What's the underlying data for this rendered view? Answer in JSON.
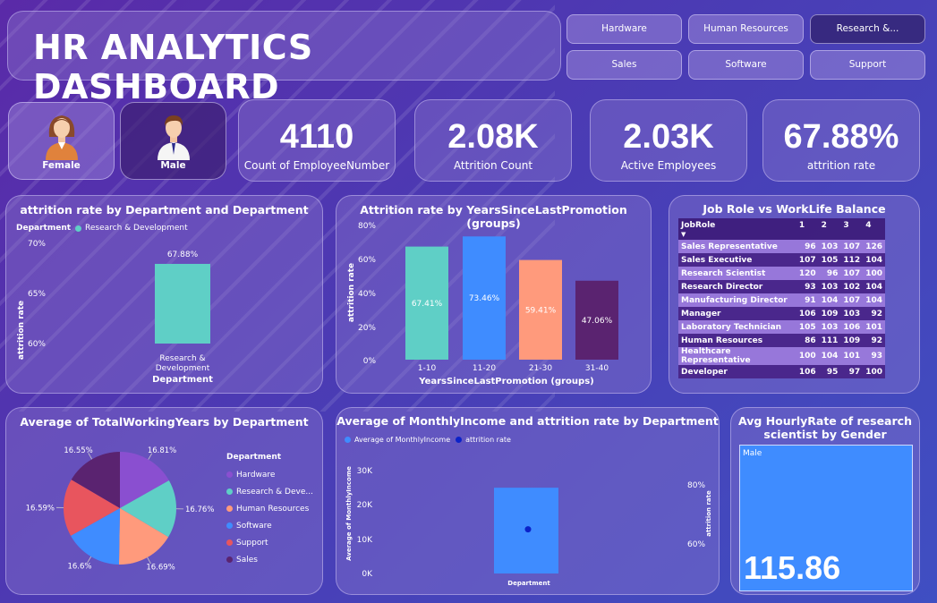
{
  "title": "HR ANALYTICS DASHBOARD",
  "slicers": [
    {
      "label": "Hardware",
      "selected": false
    },
    {
      "label": "Human Resources",
      "selected": false
    },
    {
      "label": "Research &...",
      "selected": true
    },
    {
      "label": "Sales",
      "selected": false
    },
    {
      "label": "Software",
      "selected": false
    },
    {
      "label": "Support",
      "selected": false
    }
  ],
  "gender": {
    "female": "Female",
    "male": "Male"
  },
  "kpis": [
    {
      "value": "4110",
      "caption": "Count of EmployeeNumber"
    },
    {
      "value": "2.08K",
      "caption": "Attrition Count"
    },
    {
      "value": "2.03K",
      "caption": "Active Employees"
    },
    {
      "value": "67.88%",
      "caption": "attrition rate"
    }
  ],
  "chart_data": [
    {
      "type": "bar",
      "title": "attrition rate by Department and Department",
      "legend_title": "Department",
      "legend": [
        "Research & Development"
      ],
      "categories": [
        "Research & Development"
      ],
      "category_lines": [
        "Research &",
        "Development"
      ],
      "values": [
        67.88
      ],
      "data_labels": [
        "67.88%"
      ],
      "ylabel": "attrition rate",
      "xlabel": "Department",
      "yticks": [
        "70%",
        "65%",
        "60%"
      ],
      "ylim": [
        60,
        70
      ],
      "color": "#5fcfc6"
    },
    {
      "type": "bar",
      "title": "Attrition rate by YearsSinceLastPromotion (groups)",
      "categories": [
        "1-10",
        "11-20",
        "21-30",
        "31-40"
      ],
      "values": [
        67.41,
        73.46,
        59.41,
        47.06
      ],
      "data_labels": [
        "67.41%",
        "73.46%",
        "59.41%",
        "47.06%"
      ],
      "colors": [
        "#5fcfc6",
        "#3f8cff",
        "#ff9a7c",
        "#5a2370"
      ],
      "ylabel": "attrition rate",
      "xlabel": "YearsSinceLastPromotion (groups)",
      "yticks": [
        "80%",
        "60%",
        "40%",
        "20%",
        "0%"
      ],
      "ylim": [
        0,
        80
      ]
    },
    {
      "type": "table",
      "title": "Job Role vs WorkLife Balance",
      "columns": [
        "JobRole",
        "1",
        "2",
        "3",
        "4"
      ],
      "rows": [
        [
          "Sales Representative",
          "96",
          "103",
          "107",
          "126"
        ],
        [
          "Sales Executive",
          "107",
          "105",
          "112",
          "104"
        ],
        [
          "Research Scientist",
          "120",
          "96",
          "107",
          "100"
        ],
        [
          "Research Director",
          "93",
          "103",
          "102",
          "104"
        ],
        [
          "Manufacturing Director",
          "91",
          "104",
          "107",
          "104"
        ],
        [
          "Manager",
          "106",
          "109",
          "103",
          "92"
        ],
        [
          "Laboratory Technician",
          "105",
          "103",
          "106",
          "101"
        ],
        [
          "Human Resources",
          "86",
          "111",
          "109",
          "92"
        ],
        [
          "Healthcare Representative",
          "100",
          "104",
          "101",
          "93"
        ],
        [
          "Developer",
          "106",
          "95",
          "97",
          "100"
        ]
      ]
    },
    {
      "type": "pie",
      "title": "Average of TotalWorkingYears by Department",
      "legend_title": "Department",
      "categories": [
        "Hardware",
        "Research & Deve...",
        "Human Resources",
        "Software",
        "Support",
        "Sales"
      ],
      "values": [
        16.81,
        16.76,
        16.69,
        16.6,
        16.59,
        16.55
      ],
      "data_labels": [
        "16.81%",
        "16.76%",
        "16.69%",
        "16.6%",
        "16.59%",
        "16.55%"
      ],
      "colors": [
        "#8a4fd0",
        "#5fcfc6",
        "#ff9a7c",
        "#3f8cff",
        "#e8555e",
        "#5a2370"
      ]
    },
    {
      "type": "bar",
      "title": "Average of MonthlyIncome and attrition rate by Department",
      "legend": [
        "Average of MonthlyIncome",
        "attrition rate"
      ],
      "categories": [
        "Department"
      ],
      "bar_values": [
        25000
      ],
      "line_values": [
        67.88
      ],
      "ylabel": "Average of MonthlyIncome",
      "y2label": "attrition rate",
      "xlabel": "Department",
      "yticks": [
        "30K",
        "20K",
        "10K",
        "0K"
      ],
      "ylim": [
        0,
        30000
      ],
      "y2ticks": [
        "80%",
        "60%"
      ],
      "y2lim": [
        55,
        85
      ],
      "bar_color": "#3f8cff",
      "line_color": "#0b22c9"
    },
    {
      "type": "bar",
      "title": "Avg HourlyRate of research scientist by Gender",
      "categories": [
        "Male"
      ],
      "values": [
        115.86
      ],
      "data_labels": [
        "115.86"
      ],
      "color": "#3f8cff"
    }
  ]
}
